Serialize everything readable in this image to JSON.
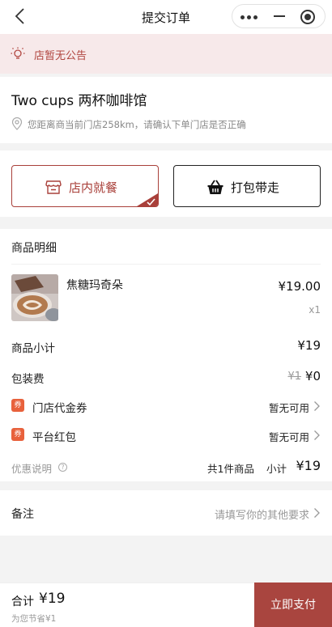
{
  "nav": {
    "title": "提交订单"
  },
  "notice": {
    "text": "店暂无公告"
  },
  "store": {
    "name": "Two cups 两杯咖啡馆",
    "distance_text": "您距离商当前门店258km，请确认下单门店是否正确"
  },
  "modes": [
    {
      "label": "店内就餐",
      "selected": true,
      "icon": "store-icon"
    },
    {
      "label": "打包带走",
      "selected": false,
      "icon": "basket-icon"
    }
  ],
  "detail": {
    "title": "商品明细",
    "item": {
      "name": "焦糖玛奇朵",
      "price": "¥19.00",
      "qty": "x1"
    },
    "subtotal": {
      "label": "商品小计",
      "value": "¥19"
    },
    "packing": {
      "label": "包装费",
      "original": "¥1",
      "value": "¥0"
    },
    "store_coupon": {
      "badge": "券",
      "label": "门店代金券",
      "value": "暂无可用"
    },
    "red_packet": {
      "badge": "券",
      "label": "平台红包",
      "value": "暂无可用"
    },
    "summary": {
      "help_label": "优惠说明",
      "help_mark": "?",
      "count": "共1件商品",
      "subtotal_label": "小计",
      "subtotal_value": "¥19"
    }
  },
  "remark": {
    "label": "备注",
    "placeholder": "请填写你的其他要求"
  },
  "footer": {
    "total_label": "合计",
    "total_value": "¥19",
    "saved_text": "为您节省¥1",
    "pay_label": "立即支付"
  },
  "colors": {
    "brand": "#a9453f",
    "notice_bg": "#f7e9ea",
    "coupon_badge": "#e8613c"
  }
}
